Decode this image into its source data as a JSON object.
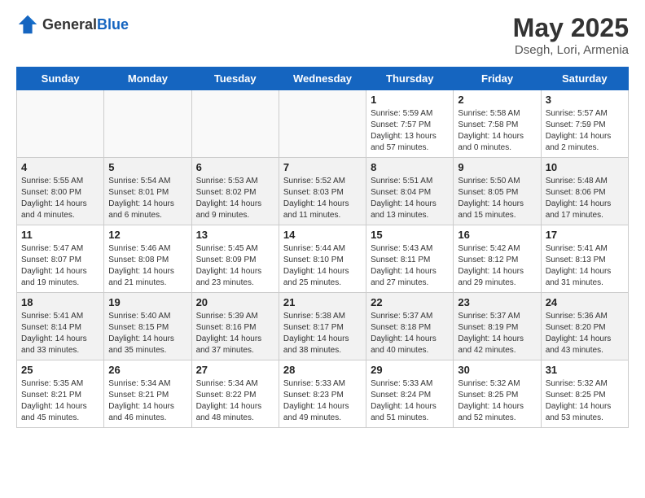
{
  "header": {
    "logo_general": "General",
    "logo_blue": "Blue",
    "month_year": "May 2025",
    "location": "Dsegh, Lori, Armenia"
  },
  "weekdays": [
    "Sunday",
    "Monday",
    "Tuesday",
    "Wednesday",
    "Thursday",
    "Friday",
    "Saturday"
  ],
  "weeks": [
    [
      {
        "day": "",
        "empty": true
      },
      {
        "day": "",
        "empty": true
      },
      {
        "day": "",
        "empty": true
      },
      {
        "day": "",
        "empty": true
      },
      {
        "day": "1",
        "sunrise": "5:59 AM",
        "sunset": "7:57 PM",
        "daylight": "13 hours and 57 minutes."
      },
      {
        "day": "2",
        "sunrise": "5:58 AM",
        "sunset": "7:58 PM",
        "daylight": "14 hours and 0 minutes."
      },
      {
        "day": "3",
        "sunrise": "5:57 AM",
        "sunset": "7:59 PM",
        "daylight": "14 hours and 2 minutes."
      }
    ],
    [
      {
        "day": "4",
        "sunrise": "5:55 AM",
        "sunset": "8:00 PM",
        "daylight": "14 hours and 4 minutes."
      },
      {
        "day": "5",
        "sunrise": "5:54 AM",
        "sunset": "8:01 PM",
        "daylight": "14 hours and 6 minutes."
      },
      {
        "day": "6",
        "sunrise": "5:53 AM",
        "sunset": "8:02 PM",
        "daylight": "14 hours and 9 minutes."
      },
      {
        "day": "7",
        "sunrise": "5:52 AM",
        "sunset": "8:03 PM",
        "daylight": "14 hours and 11 minutes."
      },
      {
        "day": "8",
        "sunrise": "5:51 AM",
        "sunset": "8:04 PM",
        "daylight": "14 hours and 13 minutes."
      },
      {
        "day": "9",
        "sunrise": "5:50 AM",
        "sunset": "8:05 PM",
        "daylight": "14 hours and 15 minutes."
      },
      {
        "day": "10",
        "sunrise": "5:48 AM",
        "sunset": "8:06 PM",
        "daylight": "14 hours and 17 minutes."
      }
    ],
    [
      {
        "day": "11",
        "sunrise": "5:47 AM",
        "sunset": "8:07 PM",
        "daylight": "14 hours and 19 minutes."
      },
      {
        "day": "12",
        "sunrise": "5:46 AM",
        "sunset": "8:08 PM",
        "daylight": "14 hours and 21 minutes."
      },
      {
        "day": "13",
        "sunrise": "5:45 AM",
        "sunset": "8:09 PM",
        "daylight": "14 hours and 23 minutes."
      },
      {
        "day": "14",
        "sunrise": "5:44 AM",
        "sunset": "8:10 PM",
        "daylight": "14 hours and 25 minutes."
      },
      {
        "day": "15",
        "sunrise": "5:43 AM",
        "sunset": "8:11 PM",
        "daylight": "14 hours and 27 minutes."
      },
      {
        "day": "16",
        "sunrise": "5:42 AM",
        "sunset": "8:12 PM",
        "daylight": "14 hours and 29 minutes."
      },
      {
        "day": "17",
        "sunrise": "5:41 AM",
        "sunset": "8:13 PM",
        "daylight": "14 hours and 31 minutes."
      }
    ],
    [
      {
        "day": "18",
        "sunrise": "5:41 AM",
        "sunset": "8:14 PM",
        "daylight": "14 hours and 33 minutes."
      },
      {
        "day": "19",
        "sunrise": "5:40 AM",
        "sunset": "8:15 PM",
        "daylight": "14 hours and 35 minutes."
      },
      {
        "day": "20",
        "sunrise": "5:39 AM",
        "sunset": "8:16 PM",
        "daylight": "14 hours and 37 minutes."
      },
      {
        "day": "21",
        "sunrise": "5:38 AM",
        "sunset": "8:17 PM",
        "daylight": "14 hours and 38 minutes."
      },
      {
        "day": "22",
        "sunrise": "5:37 AM",
        "sunset": "8:18 PM",
        "daylight": "14 hours and 40 minutes."
      },
      {
        "day": "23",
        "sunrise": "5:37 AM",
        "sunset": "8:19 PM",
        "daylight": "14 hours and 42 minutes."
      },
      {
        "day": "24",
        "sunrise": "5:36 AM",
        "sunset": "8:20 PM",
        "daylight": "14 hours and 43 minutes."
      }
    ],
    [
      {
        "day": "25",
        "sunrise": "5:35 AM",
        "sunset": "8:21 PM",
        "daylight": "14 hours and 45 minutes."
      },
      {
        "day": "26",
        "sunrise": "5:34 AM",
        "sunset": "8:21 PM",
        "daylight": "14 hours and 46 minutes."
      },
      {
        "day": "27",
        "sunrise": "5:34 AM",
        "sunset": "8:22 PM",
        "daylight": "14 hours and 48 minutes."
      },
      {
        "day": "28",
        "sunrise": "5:33 AM",
        "sunset": "8:23 PM",
        "daylight": "14 hours and 49 minutes."
      },
      {
        "day": "29",
        "sunrise": "5:33 AM",
        "sunset": "8:24 PM",
        "daylight": "14 hours and 51 minutes."
      },
      {
        "day": "30",
        "sunrise": "5:32 AM",
        "sunset": "8:25 PM",
        "daylight": "14 hours and 52 minutes."
      },
      {
        "day": "31",
        "sunrise": "5:32 AM",
        "sunset": "8:25 PM",
        "daylight": "14 hours and 53 minutes."
      }
    ]
  ]
}
